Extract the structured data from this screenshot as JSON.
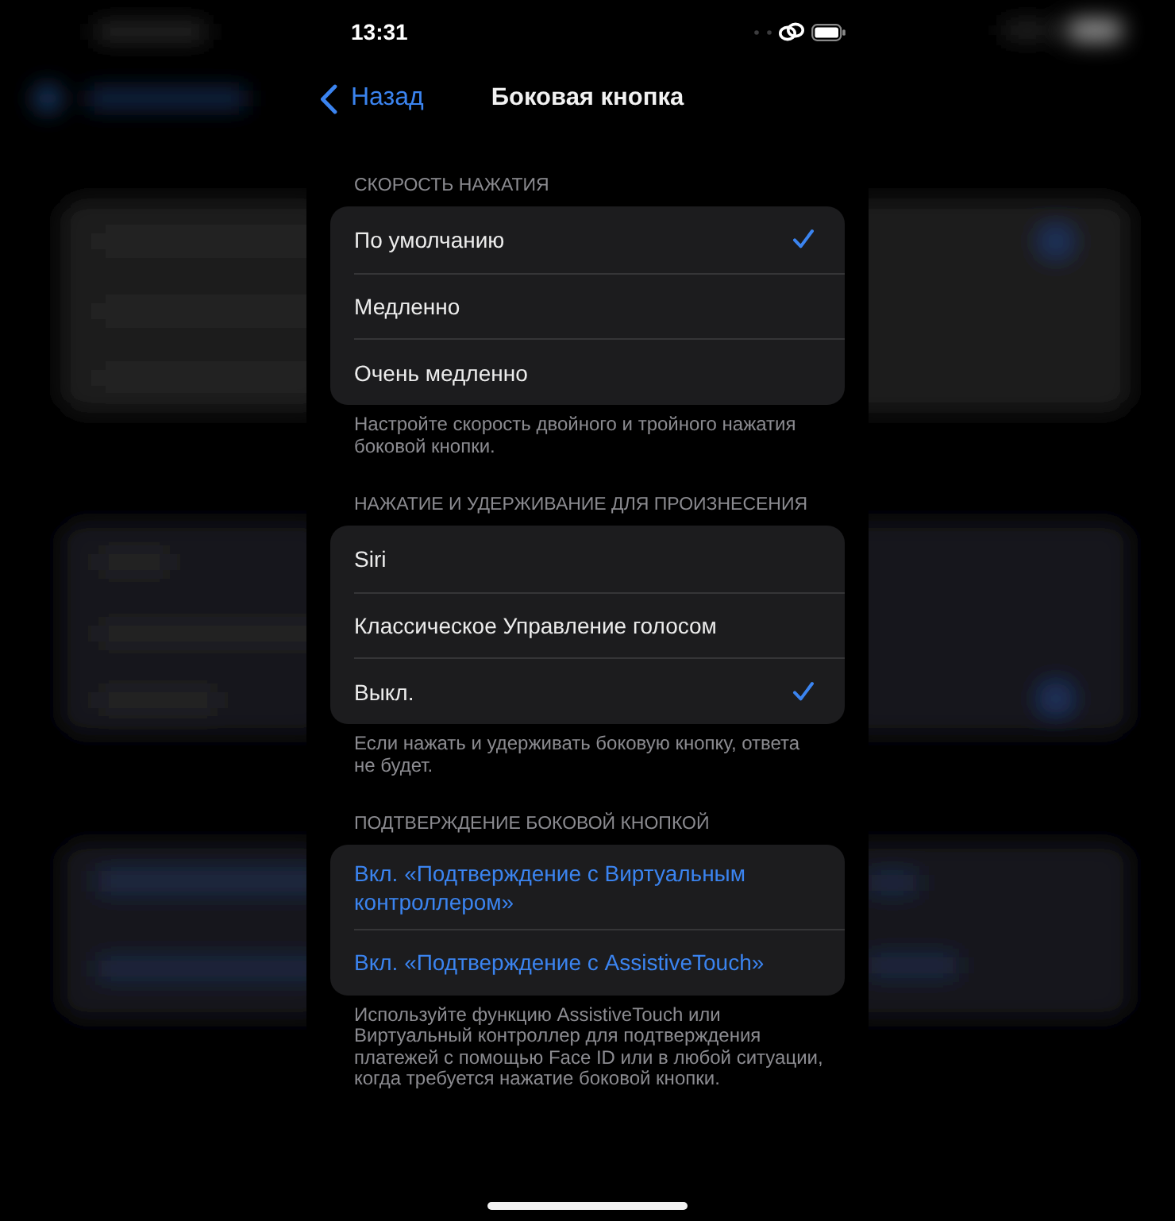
{
  "status_bar": {
    "time": "13:31"
  },
  "nav_bar": {
    "back": "Назад",
    "title": "Боковая кнопка"
  },
  "sections": [
    {
      "kind": "choice",
      "header": "СКОРОСТЬ НАЖАТИЯ",
      "options": [
        {
          "label": "По умолчанию",
          "selected": true
        },
        {
          "label": "Медленно",
          "selected": false
        },
        {
          "label": "Очень медленно",
          "selected": false
        }
      ],
      "footer": "Настройте скорость двойного и тройного нажатия боковой кнопки."
    },
    {
      "kind": "choice",
      "header": "НАЖАТИЕ И УДЕРЖИВАНИЕ ДЛЯ ПРОИЗНЕСЕНИЯ",
      "options": [
        {
          "label": "Siri",
          "selected": false
        },
        {
          "label": "Классическое Управление голосом",
          "selected": false
        },
        {
          "label": "Выкл.",
          "selected": true
        }
      ],
      "footer": "Если нажать и удерживать боковую кнопку, ответа не будет."
    },
    {
      "kind": "action",
      "header": "ПОДТВЕРЖДЕНИЕ БОКОВОЙ КНОПКОЙ",
      "options": [
        {
          "label": "Вкл. «Подтверждение с Виртуальным контроллером»"
        },
        {
          "label": "Вкл. «Подтверждение с AssistiveTouch»"
        }
      ],
      "footer": "Используйте функцию AssistiveTouch или Виртуальный контроллер для подтверждения платежей с помощью Face ID или в любой ситуации, когда требуется нажатие боковой кнопки."
    }
  ]
}
